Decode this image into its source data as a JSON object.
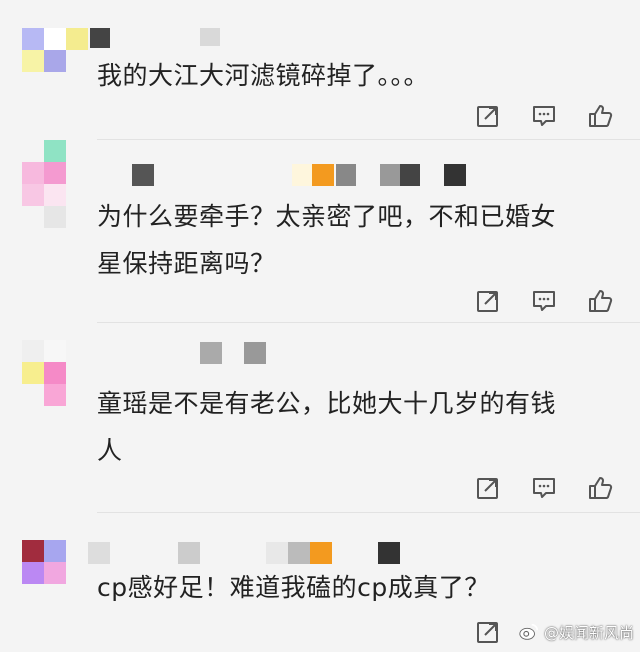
{
  "comments": [
    {
      "text": "我的大江大河滤镜碎掉了。。。"
    },
    {
      "text_line1": "为什么要牵手？太亲密了吧，不和已婚女",
      "text_line2": "星保持距离吗？"
    },
    {
      "text_line1": "童瑶是不是有老公，比她大十几岁的有钱",
      "text_line2": "人"
    },
    {
      "text": "cp感好足！难道我磕的cp成真了？"
    }
  ],
  "actions": {
    "share_icon": "share-icon",
    "reply_icon": "comment-icon",
    "like_icon": "thumbs-up-icon"
  },
  "watermark": {
    "text": "@娱闻新风尚",
    "icon": "weibo-icon"
  },
  "colors": {
    "background": "#f4f4f4",
    "text": "#222222",
    "icon": "#555555"
  }
}
